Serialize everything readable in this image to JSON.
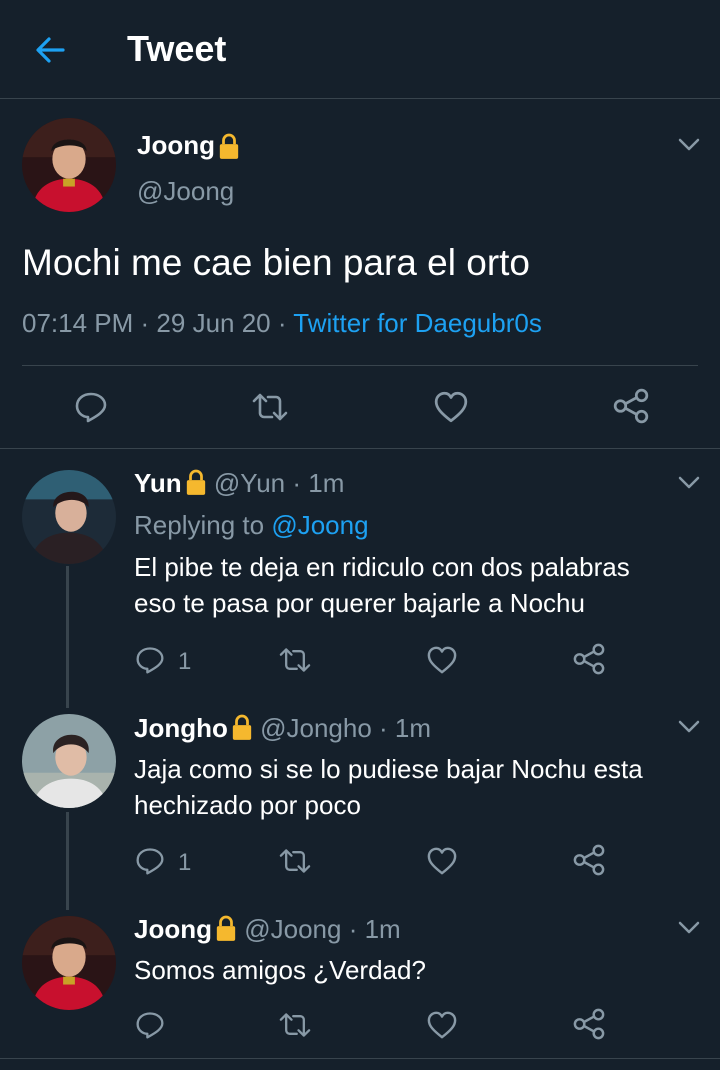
{
  "header": {
    "title": "Tweet"
  },
  "main_tweet": {
    "name": "Joong",
    "handle": "@Joong",
    "text": "Mochi me cae bien para el orto",
    "time": "07:14 PM",
    "date": "29 Jun 20",
    "source": "Twitter for Daegubr0s"
  },
  "replies": [
    {
      "name": "Yun",
      "handle": "@Yun",
      "time": "1m",
      "replying_label": "Replying to",
      "replying_to": "@Joong",
      "lines": [
        "El pibe te deja en ridiculo con dos palabras",
        "eso te pasa por querer bajarle a Nochu"
      ],
      "reply_count": "1"
    },
    {
      "name": "Jongho",
      "handle": "@Jongho",
      "time": "1m",
      "lines": [
        "Jaja como si se lo pudiese bajar Nochu esta",
        "hechizado por poco"
      ],
      "reply_count": "1"
    },
    {
      "name": "Joong",
      "handle": "@Joong",
      "time": "1m",
      "lines": [
        "Somos amigos ¿Verdad?"
      ],
      "reply_count": ""
    }
  ],
  "colors": {
    "background": "#15202b",
    "accent": "#1da1f2",
    "muted": "#8899a6",
    "lock": "#f5b82e"
  },
  "icons": [
    "back-arrow-icon",
    "lock-icon",
    "chevron-down-icon",
    "reply-icon",
    "retweet-icon",
    "like-icon",
    "share-icon"
  ]
}
